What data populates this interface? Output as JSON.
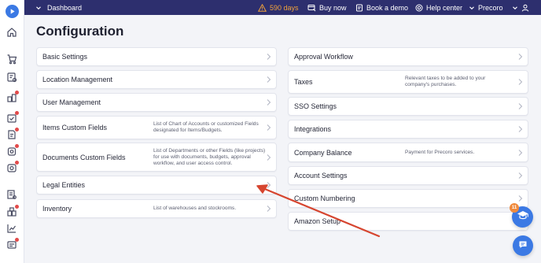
{
  "topbar": {
    "dashboard_label": "Dashboard",
    "trial_days": "590 days",
    "buy_now": "Buy now",
    "book_demo": "Book a demo",
    "help_center": "Help center",
    "company": "Precoro"
  },
  "page": {
    "title": "Configuration"
  },
  "left_cards": [
    {
      "label": "Basic Settings",
      "description": ""
    },
    {
      "label": "Location Management",
      "description": ""
    },
    {
      "label": "User Management",
      "description": ""
    },
    {
      "label": "Items Custom Fields",
      "description": "List of Chart of Accounts or customized Fields designated for Items/Budgets."
    },
    {
      "label": "Documents Custom Fields",
      "description": "List of Departments or other Fields (like projects) for use with documents, budgets, approval workflow, and user access control."
    },
    {
      "label": "Legal Entities",
      "description": ""
    },
    {
      "label": "Inventory",
      "description": "List of warehouses and stockrooms."
    }
  ],
  "right_cards": [
    {
      "label": "Approval Workflow",
      "description": ""
    },
    {
      "label": "Taxes",
      "description": "Relevant taxes to be added to your company's purchases."
    },
    {
      "label": "SSO Settings",
      "description": ""
    },
    {
      "label": "Integrations",
      "description": ""
    },
    {
      "label": "Company Balance",
      "description": "Payment for Precoro services."
    },
    {
      "label": "Account Settings",
      "description": ""
    },
    {
      "label": "Custom Numbering",
      "description": ""
    },
    {
      "label": "Amazon Setup",
      "description": ""
    }
  ],
  "learning_badge": "11",
  "colors": {
    "topbar": "#2d2f6e",
    "accent": "#3b79e4",
    "warning": "#f0a23c",
    "annotation_arrow": "#d6452f"
  }
}
